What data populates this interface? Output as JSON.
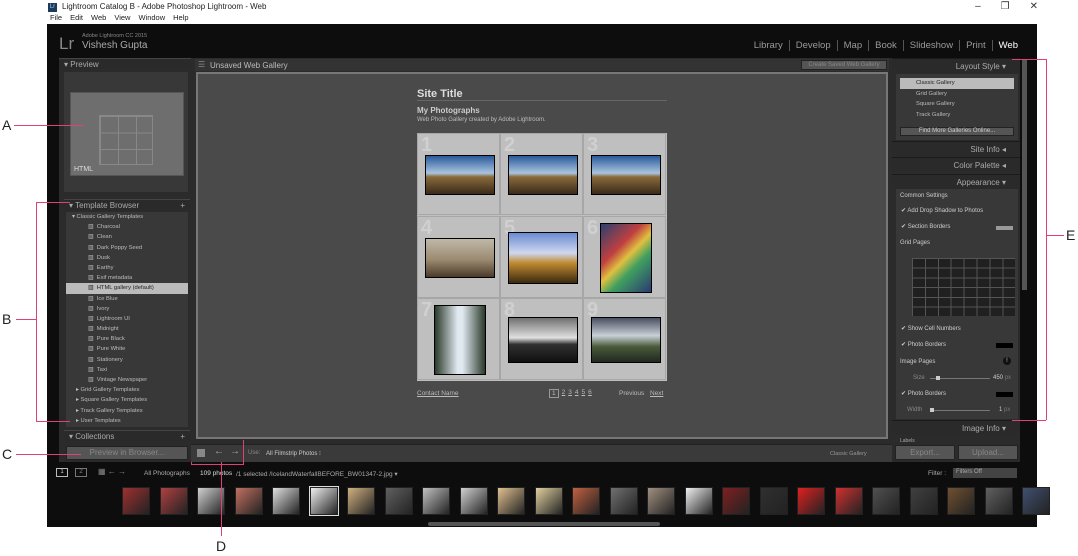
{
  "window": {
    "title": "Lightroom Catalog B - Adobe Photoshop Lightroom - Web",
    "app_icon": "Lr",
    "controls": [
      "–",
      "❐",
      "✕"
    ]
  },
  "menu": [
    "File",
    "Edit",
    "Web",
    "View",
    "Window",
    "Help"
  ],
  "header": {
    "logo": "Lr",
    "product": "Adobe Lightroom CC 2015",
    "user": "Vishesh Gupta",
    "modules": [
      "Library",
      "Develop",
      "Map",
      "Book",
      "Slideshow",
      "Print",
      "Web"
    ],
    "active_module": "Web"
  },
  "left": {
    "preview_title": "Preview",
    "preview_label": "HTML",
    "template_browser": "Template Browser",
    "folders": [
      {
        "label": "Classic Gallery Templates",
        "items": [
          "Charcoal",
          "Clean",
          "Dark Poppy Seed",
          "Dusk",
          "Earthy",
          "Exif metadata",
          "HTML gallery (default)",
          "Ice Blue",
          "Ivory",
          "Lightroom UI",
          "Midnight",
          "Pure Black",
          "Pure White",
          "Stationery",
          "Taxi",
          "Vintage Newspaper"
        ]
      }
    ],
    "other_folders": [
      "Grid Gallery Templates",
      "Square Gallery Templates",
      "Track Gallery Templates",
      "User Templates"
    ],
    "collections": "Collections",
    "preview_button": "Preview in Browser..."
  },
  "center": {
    "gallery_name": "Unsaved Web Gallery",
    "create_button": "Create Saved Web Gallery",
    "site_title": "Site Title",
    "collection_title": "My Photographs",
    "description": "Web Photo Gallery created by Adobe Lightroom.",
    "cell_numbers": [
      "1",
      "2",
      "3",
      "4",
      "5",
      "6",
      "7",
      "8",
      "9"
    ],
    "contact": "Contact Name",
    "pages": [
      "1",
      "2",
      "3",
      "4",
      "5",
      "6"
    ],
    "prev": "Previous",
    "next": "Next",
    "toolbar_use_label": "Use:",
    "toolbar_use_value": "All Filmstrip Photos",
    "layout_name": "Classic Gallery"
  },
  "right": {
    "layout_style": "Layout Style",
    "styles": [
      "Classic Gallery",
      "Grid Gallery",
      "Square Gallery",
      "Track Gallery"
    ],
    "selected_style": "Classic Gallery",
    "find_more": "Find More Galleries Online...",
    "site_info": "Site Info",
    "color_palette": "Color Palette",
    "appearance": "Appearance",
    "common_settings": "Common Settings",
    "drop_shadow": "Add Drop Shadow to Photos",
    "section_borders": "Section Borders",
    "grid_pages": "Grid Pages",
    "show_cell_numbers": "Show Cell Numbers",
    "photo_borders": "Photo Borders",
    "image_pages": "Image Pages",
    "size_label": "Size",
    "size_value": "450",
    "size_unit": "px",
    "photo_borders2": "Photo Borders",
    "width_label": "Width",
    "width_value": "1",
    "width_unit": "px",
    "image_info": "Image Info",
    "labels": "Labels",
    "export": "Export...",
    "upload": "Upload..."
  },
  "filmstrip": {
    "views": [
      "1",
      "2"
    ],
    "source": "All Photographs",
    "count": "109 photos",
    "selection": "/1 selected /IcelandWaterfallBEFORE_BW01347-2.jpg",
    "filter_label": "Filter :",
    "filter_value": "Filters Off"
  },
  "callouts": [
    "A",
    "B",
    "C",
    "D",
    "E"
  ],
  "colors": {
    "callout_line": "#e0407a",
    "accent": "#ffffff"
  }
}
